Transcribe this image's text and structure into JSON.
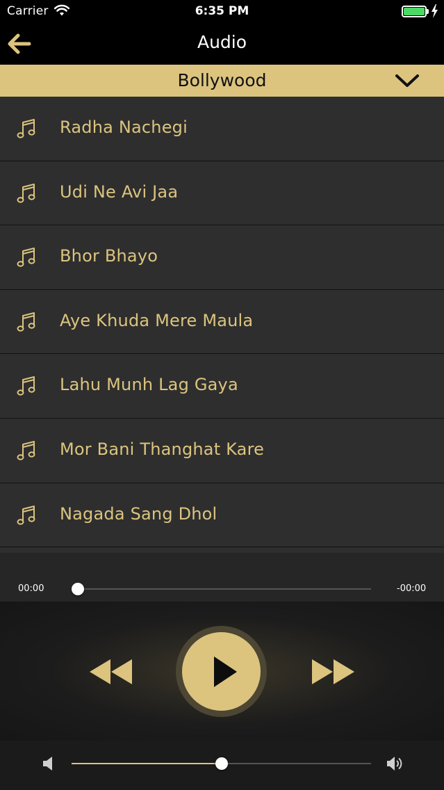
{
  "status_bar": {
    "carrier": "Carrier",
    "time": "6:35 PM",
    "battery_level": 1.0,
    "battery_color": "#4cd964",
    "charging": true
  },
  "nav": {
    "title": "Audio",
    "back_icon": "arrow-left-icon"
  },
  "category": {
    "selected": "Bollywood",
    "dropdown_icon": "chevron-down-icon"
  },
  "tracks": [
    {
      "title": "Radha Nachegi",
      "icon": "music-note-icon"
    },
    {
      "title": "Udi Ne Avi Jaa",
      "icon": "music-note-icon"
    },
    {
      "title": "Bhor Bhayo",
      "icon": "music-note-icon"
    },
    {
      "title": "Aye Khuda Mere Maula",
      "icon": "music-note-icon"
    },
    {
      "title": "Lahu Munh Lag Gaya",
      "icon": "music-note-icon"
    },
    {
      "title": "Mor Bani Thanghat Kare",
      "icon": "music-note-icon"
    },
    {
      "title": "Nagada Sang Dhol",
      "icon": "music-note-icon"
    }
  ],
  "player": {
    "elapsed": "00:00",
    "remaining": "-00:00",
    "progress": 0.02,
    "volume": 0.5,
    "icons": {
      "rewind": "rewind-icon",
      "play": "play-icon",
      "fast_forward": "fast-forward-icon",
      "volume_low": "volume-low-icon",
      "volume_high": "volume-high-icon"
    }
  },
  "colors": {
    "accent": "#dcc47f",
    "list_background": "#2e2e2e",
    "player_background": "#1b1b1b"
  }
}
